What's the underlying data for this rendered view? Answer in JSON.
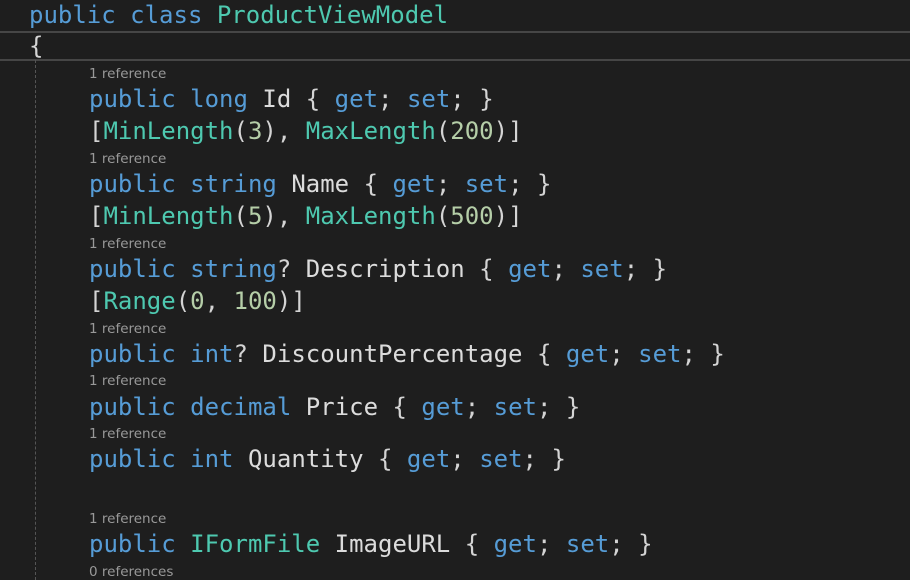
{
  "colors": {
    "background": "#1e1e1e",
    "keyword": "#569cd6",
    "type": "#4ec9b0",
    "number": "#b5cea8",
    "text": "#d4d4d4",
    "codelens": "#999999"
  },
  "code": {
    "class_decl": {
      "kw1": "public",
      "kw2": "class",
      "name": "ProductViewModel"
    },
    "open_brace": "{",
    "lens": {
      "id": "1 reference",
      "name": "1 reference",
      "description": "1 reference",
      "discount": "1 reference",
      "price": "1 reference",
      "quantity": "1 reference",
      "image": "1 reference",
      "next": "0 references"
    },
    "id_prop": {
      "mod": "public",
      "type": "long",
      "name": "Id",
      "ob": "{",
      "get": "get",
      "sc1": ";",
      "set": "set",
      "sc2": ";",
      "cb": "}"
    },
    "attr1": {
      "lb": "[",
      "a1": "MinLength",
      "p1o": "(",
      "v1": "3",
      "p1c": ")",
      "comma": ",",
      "a2": "MaxLength",
      "p2o": "(",
      "v2": "200",
      "p2c": ")",
      "rb": "]"
    },
    "name_prop": {
      "mod": "public",
      "type": "string",
      "name": "Name",
      "ob": "{",
      "get": "get",
      "sc1": ";",
      "set": "set",
      "sc2": ";",
      "cb": "}"
    },
    "attr2": {
      "lb": "[",
      "a1": "MinLength",
      "p1o": "(",
      "v1": "5",
      "p1c": ")",
      "comma": ",",
      "a2": "MaxLength",
      "p2o": "(",
      "v2": "500",
      "p2c": ")",
      "rb": "]"
    },
    "desc_prop": {
      "mod": "public",
      "type": "string",
      "q": "?",
      "name": "Description",
      "ob": "{",
      "get": "get",
      "sc1": ";",
      "set": "set",
      "sc2": ";",
      "cb": "}"
    },
    "attr3": {
      "lb": "[",
      "a1": "Range",
      "po": "(",
      "v1": "0",
      "comma": ",",
      "v2": "100",
      "pc": ")",
      "rb": "]"
    },
    "disc_prop": {
      "mod": "public",
      "type": "int",
      "q": "?",
      "name": "DiscountPercentage",
      "ob": "{",
      "get": "get",
      "sc1": ";",
      "set": "set",
      "sc2": ";",
      "cb": "}"
    },
    "price_prop": {
      "mod": "public",
      "type": "decimal",
      "name": "Price",
      "ob": "{",
      "get": "get",
      "sc1": ";",
      "set": "set",
      "sc2": ";",
      "cb": "}"
    },
    "qty_prop": {
      "mod": "public",
      "type": "int",
      "name": "Quantity",
      "ob": "{",
      "get": "get",
      "sc1": ";",
      "set": "set",
      "sc2": ";",
      "cb": "}"
    },
    "img_prop": {
      "mod": "public",
      "type": "IFormFile",
      "name": "ImageURL",
      "ob": "{",
      "get": "get",
      "sc1": ";",
      "set": "set",
      "sc2": ";",
      "cb": "}"
    }
  }
}
